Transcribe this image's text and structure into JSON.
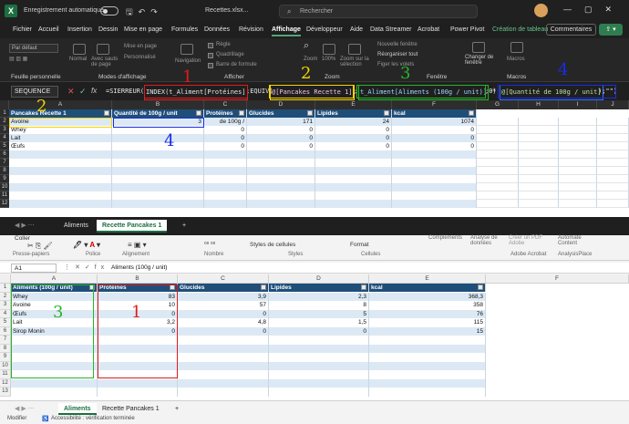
{
  "top": {
    "autosave_label": "Enregistrement automatique",
    "filename": "Recettes.xlsx...",
    "search_placeholder": "Rechercher",
    "menu": [
      "Fichier",
      "Accueil",
      "Insertion",
      "Dessin",
      "Mise en page",
      "Formules",
      "Données",
      "Révision",
      "Affichage",
      "Développeur",
      "Aide",
      "Data Streamer",
      "Acrobat",
      "Power Pivot",
      "Création de tableau"
    ],
    "active_menu": "Affichage",
    "comments_btn": "Commentaires",
    "ribbon": {
      "sheet_view_dropdown": "Par défaut",
      "normal": "Normal",
      "page_break": "Avec sauts de page",
      "page_layout": "Mise en page",
      "custom": "Personnalisé",
      "navigation": "Navigation",
      "grid_checkbox": "Règle",
      "gridlines": "Quadrillage",
      "headings": "Barre de formule",
      "zoom": "Zoom",
      "zoom100": "100%",
      "zoom_sel": "Zoom sur la sélection",
      "new_window": "Nouvelle fenêtre",
      "arrange": "Réorganiser tout",
      "freeze": "Figer les volets",
      "switch_windows": "Changer de fenêtre",
      "macros": "Macros",
      "group_sheet_view": "Feuille personnelle",
      "group_workbook_views": "Modes d'affichage",
      "group_show": "Afficher",
      "group_zoom": "Zoom",
      "group_window": "Fenêtre",
      "group_macros": "Macros"
    },
    "namebox": "SEQUENCE",
    "formula": {
      "p0": "=SIERREUR(",
      "p1": "INDEX(t_Aliment[Protéines]",
      "p2": ";EQUIV(",
      "p3": "@[Pancakes Recette 1]",
      "p4": ";",
      "p5": "t_Aliment[Aliments (100g / unit)]",
      "p6": ";0)",
      "p7": "*",
      "p8": "@[Quantité de 100g / unit]",
      "p9": ");\"\")"
    },
    "columns": [
      "A",
      "B",
      "C",
      "D",
      "E",
      "F",
      "G",
      "H",
      "I",
      "J"
    ],
    "table_headers": [
      "Pancakes Recette 1",
      "Quantité de 100g / unit",
      "Protéines",
      "Glucides",
      "Lipides",
      "kcal"
    ],
    "rows": [
      {
        "name": "Avoine",
        "qty": "3",
        "prot": "de 100g /",
        "glu": "171",
        "lip": "24",
        "kcal": "1074"
      },
      {
        "name": "Whey",
        "qty": "",
        "prot": "0",
        "glu": "0",
        "lip": "0",
        "kcal": "0"
      },
      {
        "name": "Lait",
        "qty": "",
        "prot": "0",
        "glu": "0",
        "lip": "0",
        "kcal": "0"
      },
      {
        "name": "Œufs",
        "qty": "",
        "prot": "0",
        "glu": "0",
        "lip": "0",
        "kcal": "0"
      }
    ],
    "row_numbers": [
      "1",
      "2",
      "3",
      "4",
      "5",
      "6",
      "7",
      "8",
      "9",
      "10",
      "11",
      "12"
    ],
    "tabs": [
      "Aliments",
      "Recette Pancakes 1"
    ],
    "add_tab": "+"
  },
  "bottom": {
    "ribbon_items": [
      "Coller",
      "Presse-papiers",
      "Police",
      "Alignement",
      "Nombre",
      "Styles de cellules",
      "Styles",
      "Format",
      "Cellules",
      "Compléments",
      "Analyse de données",
      "Créer un PDF Adobe",
      "Automate Content",
      "Adobe Acrobat",
      "AnalysisPlace"
    ],
    "namebox": "A1",
    "formula": "Aliments (100g / unit)",
    "columns": [
      "A",
      "B",
      "C",
      "D",
      "E",
      "F"
    ],
    "table_headers": [
      "Aliments (100g / unit)",
      "Protéines",
      "Glucides",
      "Lipides",
      "kcal"
    ],
    "rows": [
      {
        "name": "Whey",
        "prot": "83",
        "glu": "3,9",
        "lip": "2,3",
        "kcal": "368,3"
      },
      {
        "name": "Avoine",
        "prot": "10",
        "glu": "57",
        "lip": "8",
        "kcal": "358"
      },
      {
        "name": "Œufs",
        "prot": "0",
        "glu": "0",
        "lip": "5",
        "kcal": "76"
      },
      {
        "name": "Lait",
        "prot": "3,2",
        "glu": "4,8",
        "lip": "1,5",
        "kcal": "115"
      },
      {
        "name": "Sirop Monin",
        "prot": "0",
        "glu": "0",
        "lip": "0",
        "kcal": "15"
      }
    ],
    "row_numbers": [
      "1",
      "2",
      "3",
      "4",
      "5",
      "6",
      "7",
      "8",
      "9",
      "10",
      "11",
      "12",
      "13"
    ],
    "tabs": [
      "Aliments",
      "Recette Pancakes 1"
    ],
    "add_tab": "+",
    "status_mode": "Modifier",
    "status_accessibility": "Accessibilité : vérification terminée"
  },
  "annotations": {
    "n1": "1",
    "n2": "2",
    "n3": "3",
    "n4": "4"
  },
  "colors": {
    "excel_green": "#1d6f42",
    "table_header": "#1f4e79",
    "band_light": "#dce9f5",
    "red": "#e01b1b",
    "yellow": "#f5d400",
    "green": "#28b428",
    "blue": "#1a2be8"
  }
}
